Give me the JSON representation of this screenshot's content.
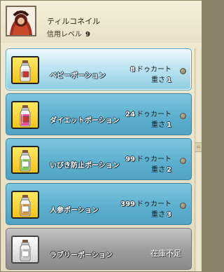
{
  "npc": {
    "name": "ティルコネイル",
    "trust_label": "信用レベル",
    "trust_level": "9",
    "portrait_icon": "npc-portrait-icon"
  },
  "items": [
    {
      "name": "ベビーポーション",
      "price": "8",
      "currency": "ドゥカート",
      "weight_label": "重さ",
      "weight": "1",
      "icon": "potion-bottle-icon",
      "liquid_color": "#e8e2da",
      "label_color": "#c23a2e",
      "state": "selected"
    },
    {
      "name": "ダイエットポーション",
      "price": "24",
      "currency": "ドゥカート",
      "weight_label": "重さ",
      "weight": "1",
      "icon": "potion-bottle-icon",
      "liquid_color": "#e0338a",
      "label_color": "#c23a2e",
      "state": "normal"
    },
    {
      "name": "いびき防止ポーション",
      "price": "99",
      "currency": "ドゥカート",
      "weight_label": "重さ",
      "weight": "2",
      "icon": "potion-bottle-icon",
      "liquid_color": "#6fbf3d",
      "label_color": "#ffffff",
      "state": "normal"
    },
    {
      "name": "人参ポーション",
      "price": "399",
      "currency": "ドゥカート",
      "weight_label": "重さ",
      "weight": "3",
      "icon": "potion-bottle-icon",
      "liquid_color": "#c98a2a",
      "label_color": "#ffffff",
      "state": "normal"
    },
    {
      "name": "ラブリーポーション",
      "stock_status": "在庫不足",
      "icon": "potion-bottle-icon",
      "liquid_color": "#bdbdbd",
      "label_color": "#ffffff",
      "state": "soldout"
    }
  ],
  "colors": {
    "row_blue": "#5db1cf",
    "row_selected": "#c9e9f4",
    "icon_frame_yellow": "#f3c51a",
    "soldout_gray": "#9e9e9e"
  }
}
